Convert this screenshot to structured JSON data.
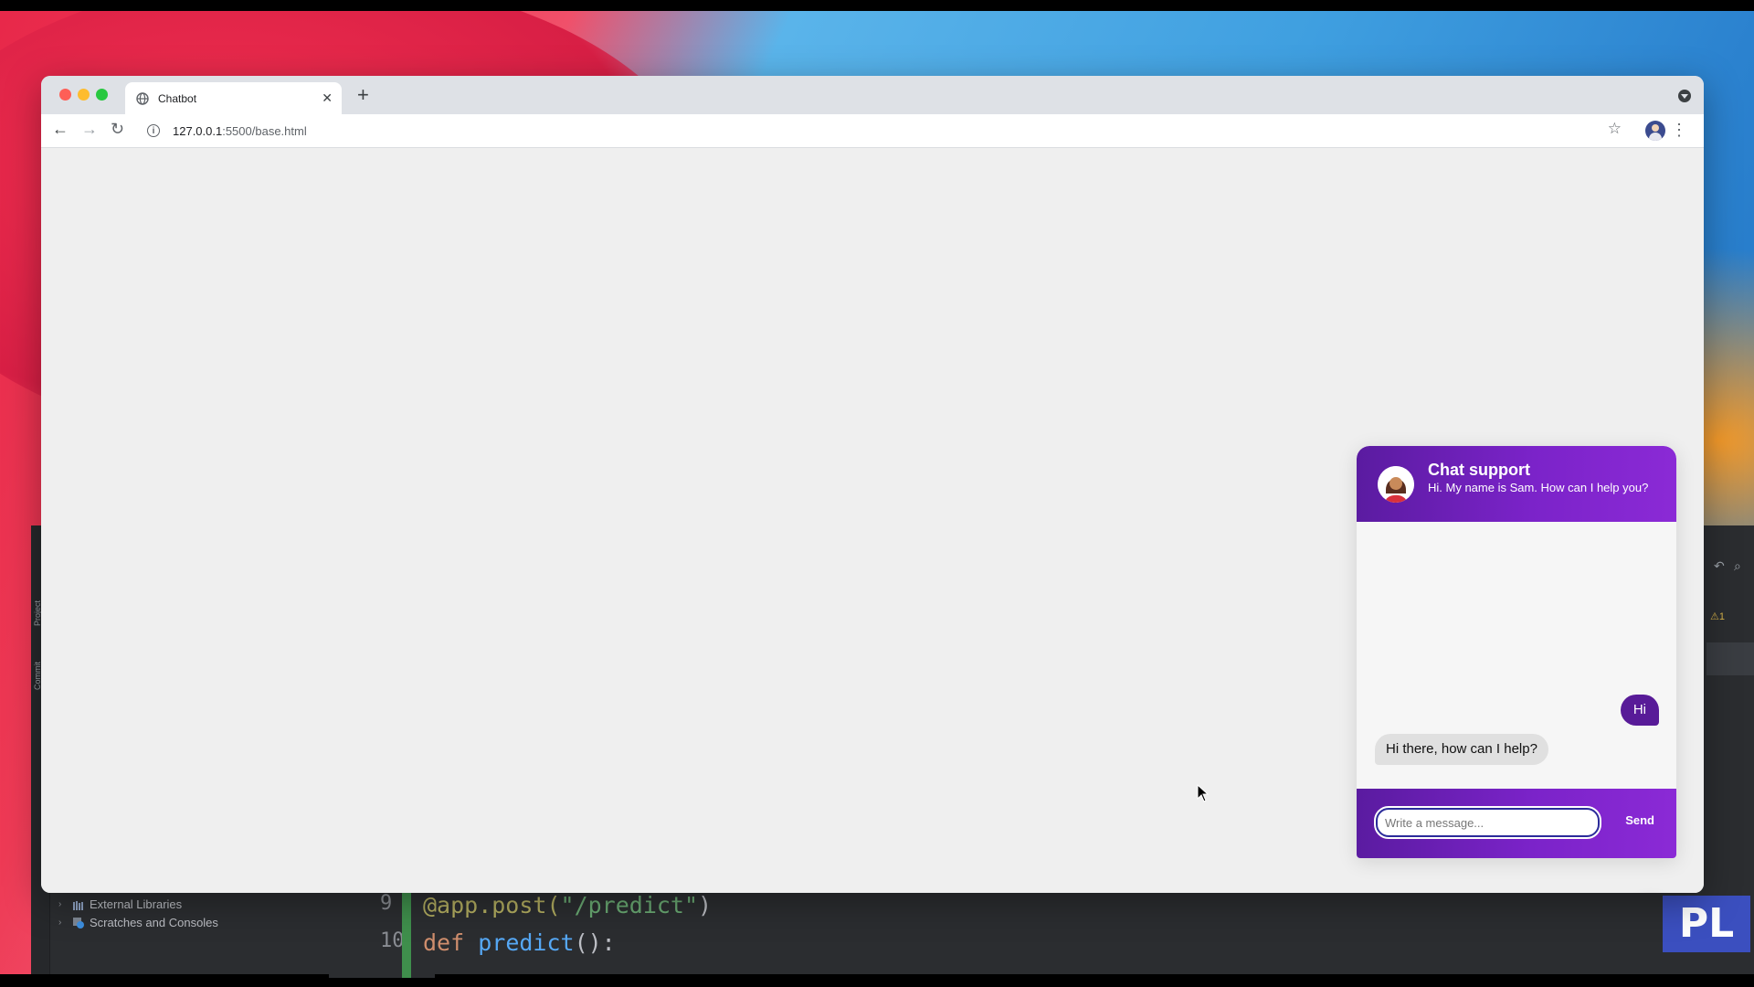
{
  "browser": {
    "tab_title": "Chatbot",
    "url_host": "127.0.0.1",
    "url_path": ":5500/base.html"
  },
  "chat": {
    "header_title": "Chat support",
    "header_subtitle": "Hi. My name is Sam. How can I help you?",
    "messages": [
      {
        "from": "user",
        "text": "Hi"
      },
      {
        "from": "bot",
        "text": "Hi there, how can I help?"
      }
    ],
    "input_placeholder": "Write a message...",
    "send_label": "Send"
  },
  "ide": {
    "tree": [
      "External Libraries",
      "Scratches and Consoles"
    ],
    "line_numbers": [
      "9",
      "10"
    ],
    "code": {
      "line9_decorator": "@app.post(",
      "line9_string": "\"/predict\"",
      "line9_close": ")",
      "line10_kw": "def ",
      "line10_fn": "predict",
      "line10_rest": "():"
    },
    "warning_count": "1",
    "side_labels": [
      "Project",
      "Commit"
    ],
    "logo": "PL"
  },
  "colors": {
    "chat_purple": "#7b23c9",
    "user_bubble": "#581b98",
    "bot_bubble": "#e0e0e0"
  }
}
